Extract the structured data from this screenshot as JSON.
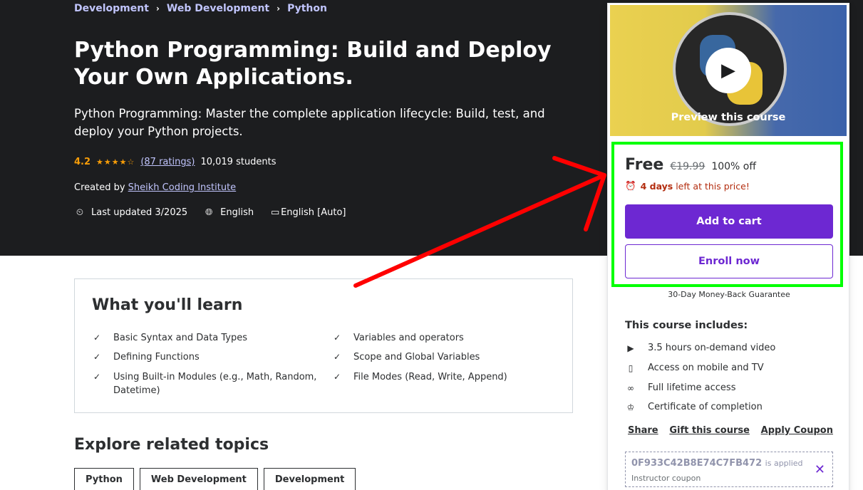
{
  "breadcrumb": [
    "Development",
    "Web Development",
    "Python"
  ],
  "course": {
    "title": "Python Programming: Build and Deploy Your Own Applications.",
    "subtitle": "Python Programming: Master the complete application lifecycle: Build, test, and deploy your Python projects.",
    "rating": "4.2",
    "stars": "★★★★☆",
    "ratings_count": "(87 ratings)",
    "students": "10,019 students",
    "created_by_label": "Created by",
    "instructor": "Sheikh Coding Institute",
    "last_updated": "Last updated 3/2025",
    "language": "English",
    "captions": "English [Auto]"
  },
  "learn": {
    "title": "What you'll learn",
    "items": [
      "Basic Syntax and Data Types",
      "Variables and operators",
      "Defining Functions",
      "Scope and Global Variables",
      "Using Built-in Modules (e.g., Math, Random, Datetime)",
      "File Modes (Read, Write, Append)"
    ]
  },
  "explore": {
    "title": "Explore related topics",
    "topics": [
      "Python",
      "Web Development",
      "Development"
    ]
  },
  "sidebar": {
    "preview_label": "Preview this course",
    "price": "Free",
    "original_price": "€19.99",
    "discount": "100% off",
    "timer_bold": "4 days",
    "timer_rest": "left at this price!",
    "add_to_cart": "Add to cart",
    "enroll_now": "Enroll now",
    "guarantee": "30-Day Money-Back Guarantee",
    "includes_title": "This course includes:",
    "includes": [
      {
        "icon": "video-icon",
        "text": "3.5 hours on-demand video"
      },
      {
        "icon": "mobile-icon",
        "text": "Access on mobile and TV"
      },
      {
        "icon": "infinity-icon",
        "text": "Full lifetime access"
      },
      {
        "icon": "trophy-icon",
        "text": "Certificate of completion"
      }
    ],
    "links": [
      "Share",
      "Gift this course",
      "Apply Coupon"
    ],
    "coupon_code": "0F933C42B8E74C7FB472",
    "coupon_applied": "is applied",
    "coupon_sub": "Instructor coupon"
  },
  "colors": {
    "hero_bg": "#1c1d1f",
    "accent_purple": "#6d28d2",
    "rating_orange": "#f69c08",
    "highlight_green": "#00ff00",
    "arrow_red": "#ff0000"
  }
}
